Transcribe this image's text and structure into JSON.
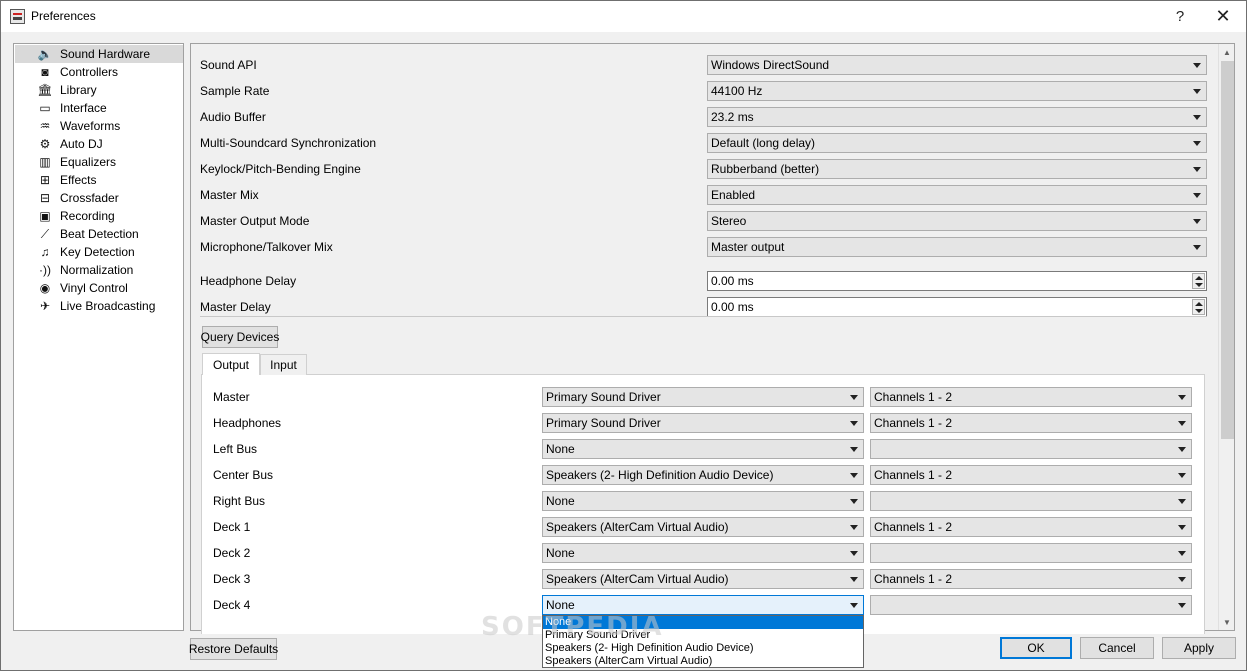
{
  "window": {
    "title": "Preferences",
    "help_glyph": "?",
    "close_glyph": "✕"
  },
  "sidebar": {
    "items": [
      {
        "label": "Sound Hardware",
        "icon": "speaker-icon",
        "glyph": "🔈",
        "selected": true
      },
      {
        "label": "Controllers",
        "icon": "controller-icon",
        "glyph": "◙"
      },
      {
        "label": "Library",
        "icon": "library-icon",
        "glyph": "🏛"
      },
      {
        "label": "Interface",
        "icon": "monitor-icon",
        "glyph": "▭"
      },
      {
        "label": "Waveforms",
        "icon": "waveform-icon",
        "glyph": "♒"
      },
      {
        "label": "Auto DJ",
        "icon": "robot-icon",
        "glyph": "⚙"
      },
      {
        "label": "Equalizers",
        "icon": "equalizer-icon",
        "glyph": "▥"
      },
      {
        "label": "Effects",
        "icon": "effects-icon",
        "glyph": "⊞"
      },
      {
        "label": "Crossfader",
        "icon": "crossfader-icon",
        "glyph": "⊟"
      },
      {
        "label": "Recording",
        "icon": "recording-icon",
        "glyph": "▣"
      },
      {
        "label": "Beat Detection",
        "icon": "beat-detection-icon",
        "glyph": "⟋"
      },
      {
        "label": "Key Detection",
        "icon": "key-detection-icon",
        "glyph": "♫"
      },
      {
        "label": "Normalization",
        "icon": "normalization-icon",
        "glyph": "·))"
      },
      {
        "label": "Vinyl Control",
        "icon": "vinyl-icon",
        "glyph": "◉"
      },
      {
        "label": "Live Broadcasting",
        "icon": "broadcast-icon",
        "glyph": "✈"
      }
    ]
  },
  "settings": {
    "rows": [
      {
        "label": "Sound API",
        "value": "Windows DirectSound",
        "kind": "combo"
      },
      {
        "label": "Sample Rate",
        "value": "44100 Hz",
        "kind": "combo"
      },
      {
        "label": "Audio Buffer",
        "value": "23.2 ms",
        "kind": "combo"
      },
      {
        "label": "Multi-Soundcard Synchronization",
        "value": "Default (long delay)",
        "kind": "combo"
      },
      {
        "label": "Keylock/Pitch-Bending Engine",
        "value": "Rubberband (better)",
        "kind": "combo"
      },
      {
        "label": "Master Mix",
        "value": "Enabled",
        "kind": "combo"
      },
      {
        "label": "Master Output Mode",
        "value": "Stereo",
        "kind": "combo"
      },
      {
        "label": "Microphone/Talkover Mix",
        "value": "Master output",
        "kind": "combo"
      },
      {
        "label": "Headphone Delay",
        "value": "0.00 ms",
        "kind": "spin"
      },
      {
        "label": "Master Delay",
        "value": "0.00 ms",
        "kind": "spin"
      }
    ]
  },
  "query_devices_label": "Query Devices",
  "tabs": [
    {
      "label": "Output",
      "active": true
    },
    {
      "label": "Input",
      "active": false
    }
  ],
  "output": {
    "rows": [
      {
        "label": "Master",
        "device": "Primary Sound Driver",
        "channels": "Channels 1 - 2"
      },
      {
        "label": "Headphones",
        "device": "Primary Sound Driver",
        "channels": "Channels 1 - 2"
      },
      {
        "label": "Left Bus",
        "device": "None",
        "channels": ""
      },
      {
        "label": "Center Bus",
        "device": "Speakers (2- High Definition Audio Device)",
        "channels": "Channels 1 - 2"
      },
      {
        "label": "Right Bus",
        "device": "None",
        "channels": ""
      },
      {
        "label": "Deck 1",
        "device": "Speakers (AlterCam Virtual Audio)",
        "channels": "Channels 1 - 2"
      },
      {
        "label": "Deck 2",
        "device": "None",
        "channels": ""
      },
      {
        "label": "Deck 3",
        "device": "Speakers (AlterCam Virtual Audio)",
        "channels": "Channels 1 - 2"
      },
      {
        "label": "Deck 4",
        "device": "None",
        "channels": ""
      }
    ]
  },
  "dropdown": {
    "options": [
      "None",
      "Primary Sound Driver",
      "Speakers (2- High Definition Audio Device)",
      "Speakers (AlterCam Virtual Audio)"
    ],
    "highlighted": "None"
  },
  "footer": {
    "restore_defaults": "Restore Defaults",
    "ok": "OK",
    "cancel": "Cancel",
    "apply": "Apply"
  },
  "watermark": "SOFTPEDIA"
}
